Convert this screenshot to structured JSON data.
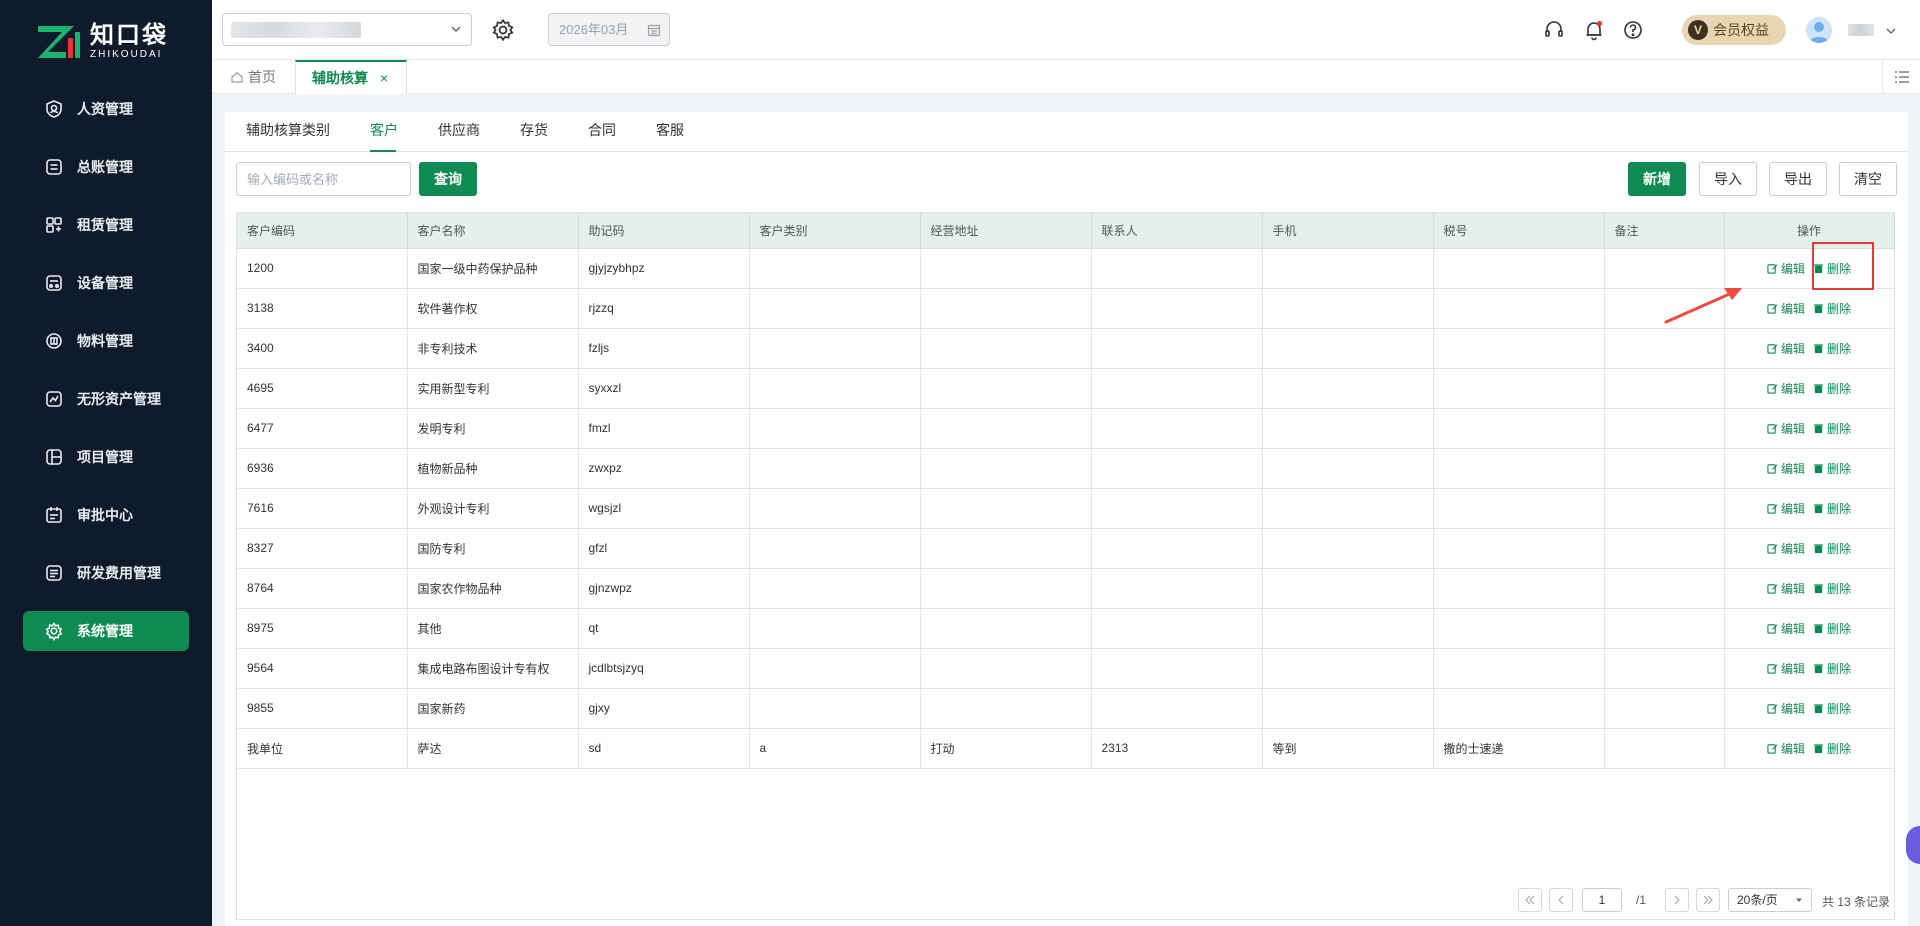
{
  "brand": {
    "name_cn": "知口袋",
    "name_en": "ZHIKOUDAI"
  },
  "sidebar": {
    "items": [
      {
        "label": "人资管理",
        "icon": "user-shield-icon",
        "active": false
      },
      {
        "label": "总账管理",
        "icon": "ledger-icon",
        "active": false
      },
      {
        "label": "租赁管理",
        "icon": "lease-icon",
        "active": false
      },
      {
        "label": "设备管理",
        "icon": "device-icon",
        "active": false
      },
      {
        "label": "物料管理",
        "icon": "box-icon",
        "active": false
      },
      {
        "label": "无形资产管理",
        "icon": "asset-chart-icon",
        "active": false
      },
      {
        "label": "项目管理",
        "icon": "project-icon",
        "active": false
      },
      {
        "label": "审批中心",
        "icon": "approval-icon",
        "active": false
      },
      {
        "label": "研发费用管理",
        "icon": "rd-cost-icon",
        "active": false
      },
      {
        "label": "系统管理",
        "icon": "gear-icon",
        "active": true
      }
    ]
  },
  "header": {
    "period": "2026年03月",
    "vip_label": "会员权益",
    "vip_badge": "V"
  },
  "tabs": {
    "home": "首页",
    "active": "辅助核算",
    "close": "×"
  },
  "subtabs": [
    "辅助核算类别",
    "客户",
    "供应商",
    "存货",
    "合同",
    "客服"
  ],
  "toolbar": {
    "search_placeholder": "输入编码或名称",
    "query": "查询",
    "add": "新增",
    "import": "导入",
    "export": "导出",
    "clear": "清空"
  },
  "table": {
    "columns": [
      "客户编码",
      "客户名称",
      "助记码",
      "客户类别",
      "经营地址",
      "联系人",
      "手机",
      "税号",
      "备注",
      "操作"
    ],
    "edit_label": "编辑",
    "delete_label": "删除",
    "rows": [
      [
        "1200",
        "国家一级中药保护品种",
        "gjyjzybhpz",
        "",
        "",
        "",
        "",
        "",
        ""
      ],
      [
        "3138",
        "软件著作权",
        "rjzzq",
        "",
        "",
        "",
        "",
        "",
        ""
      ],
      [
        "3400",
        "非专利技术",
        "fzljs",
        "",
        "",
        "",
        "",
        "",
        ""
      ],
      [
        "4695",
        "实用新型专利",
        "syxxzl",
        "",
        "",
        "",
        "",
        "",
        ""
      ],
      [
        "6477",
        "发明专利",
        "fmzl",
        "",
        "",
        "",
        "",
        "",
        ""
      ],
      [
        "6936",
        "植物新品种",
        "zwxpz",
        "",
        "",
        "",
        "",
        "",
        ""
      ],
      [
        "7616",
        "外观设计专利",
        "wgsjzl",
        "",
        "",
        "",
        "",
        "",
        ""
      ],
      [
        "8327",
        "国防专利",
        "gfzl",
        "",
        "",
        "",
        "",
        "",
        ""
      ],
      [
        "8764",
        "国家农作物品种",
        "gjnzwpz",
        "",
        "",
        "",
        "",
        "",
        ""
      ],
      [
        "8975",
        "其他",
        "qt",
        "",
        "",
        "",
        "",
        "",
        ""
      ],
      [
        "9564",
        "集成电路布图设计专有权",
        "jcdlbtsjzyq",
        "",
        "",
        "",
        "",
        "",
        ""
      ],
      [
        "9855",
        "国家新药",
        "gjxy",
        "",
        "",
        "",
        "",
        "",
        ""
      ],
      [
        "我单位",
        "萨达",
        "sd",
        "a",
        "打动",
        "2313",
        "等到",
        "撒的士速递",
        ""
      ]
    ]
  },
  "pagination": {
    "current_page": "1",
    "total_pages": "/1",
    "page_size": "20条/页",
    "total_records": "共 13 条记录"
  },
  "colors": {
    "accent": "#0f8a52",
    "sidebar_bg": "#0f1b2a",
    "header_row": "#e3f1ea",
    "highlight": "#e53935"
  }
}
